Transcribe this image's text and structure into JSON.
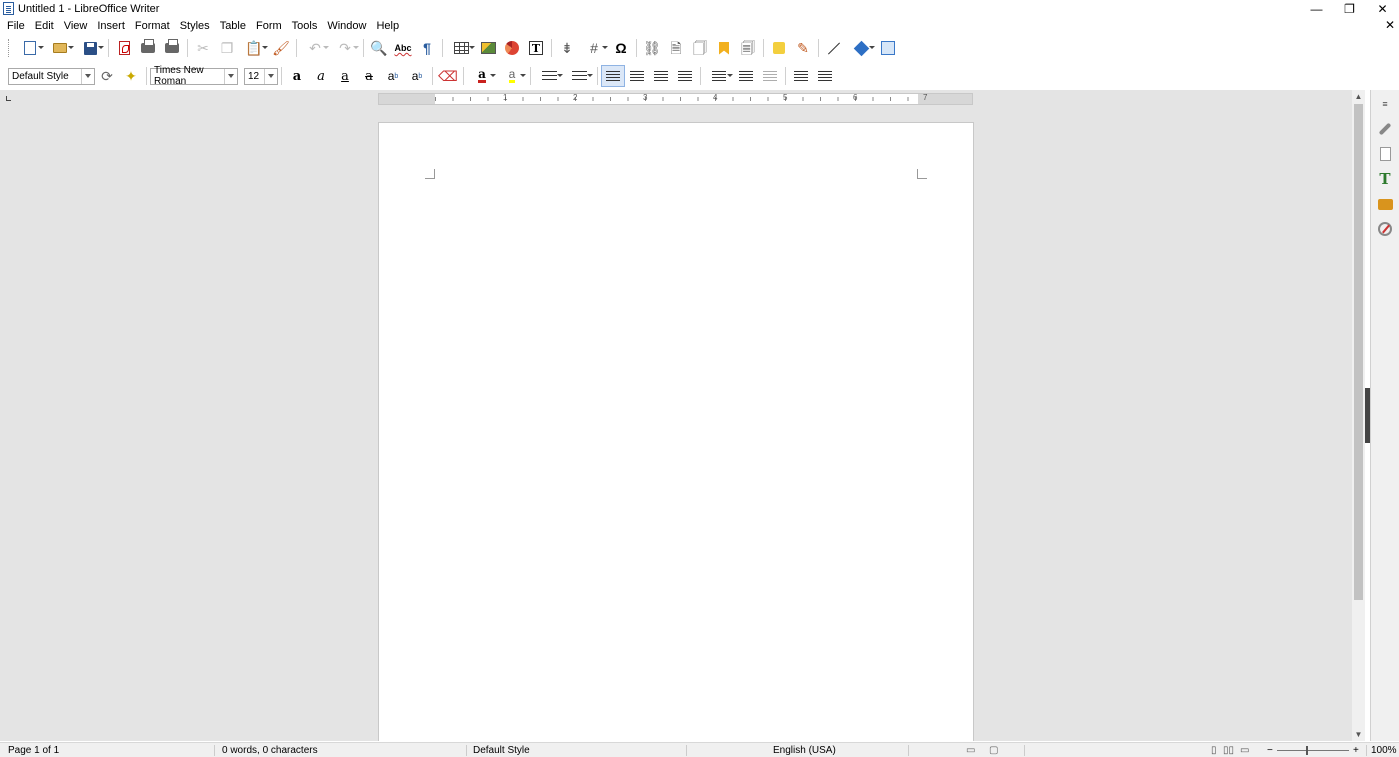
{
  "window": {
    "title": "Untitled 1 - LibreOffice Writer",
    "minimize": "—",
    "restore": "❐",
    "close": "✕",
    "close_doc": "✕"
  },
  "menu": [
    "File",
    "Edit",
    "View",
    "Insert",
    "Format",
    "Styles",
    "Table",
    "Form",
    "Tools",
    "Window",
    "Help"
  ],
  "formatting": {
    "paragraph_style": "Default Style",
    "font_name": "Times New Roman",
    "font_size": "12",
    "bold": "a",
    "italic": "a",
    "underline": "a",
    "strike": "a",
    "superscript": "a",
    "subscript": "a",
    "font_color_glyph": "a",
    "highlight_glyph": "a",
    "font_color": "#c9211e",
    "highlight_color": "#ffff00"
  },
  "standard": {
    "spelling": "Abc",
    "pilcrow": "¶",
    "special_char": "Ω"
  },
  "ruler": {
    "numbers": [
      "1",
      "2",
      "3",
      "4",
      "5",
      "6",
      "7"
    ]
  },
  "statusbar": {
    "page": "Page 1 of 1",
    "words": "0 words, 0 characters",
    "style": "Default Style",
    "language": "English (USA)",
    "zoom_minus": "−",
    "zoom_plus": "+",
    "zoom": "100%"
  }
}
